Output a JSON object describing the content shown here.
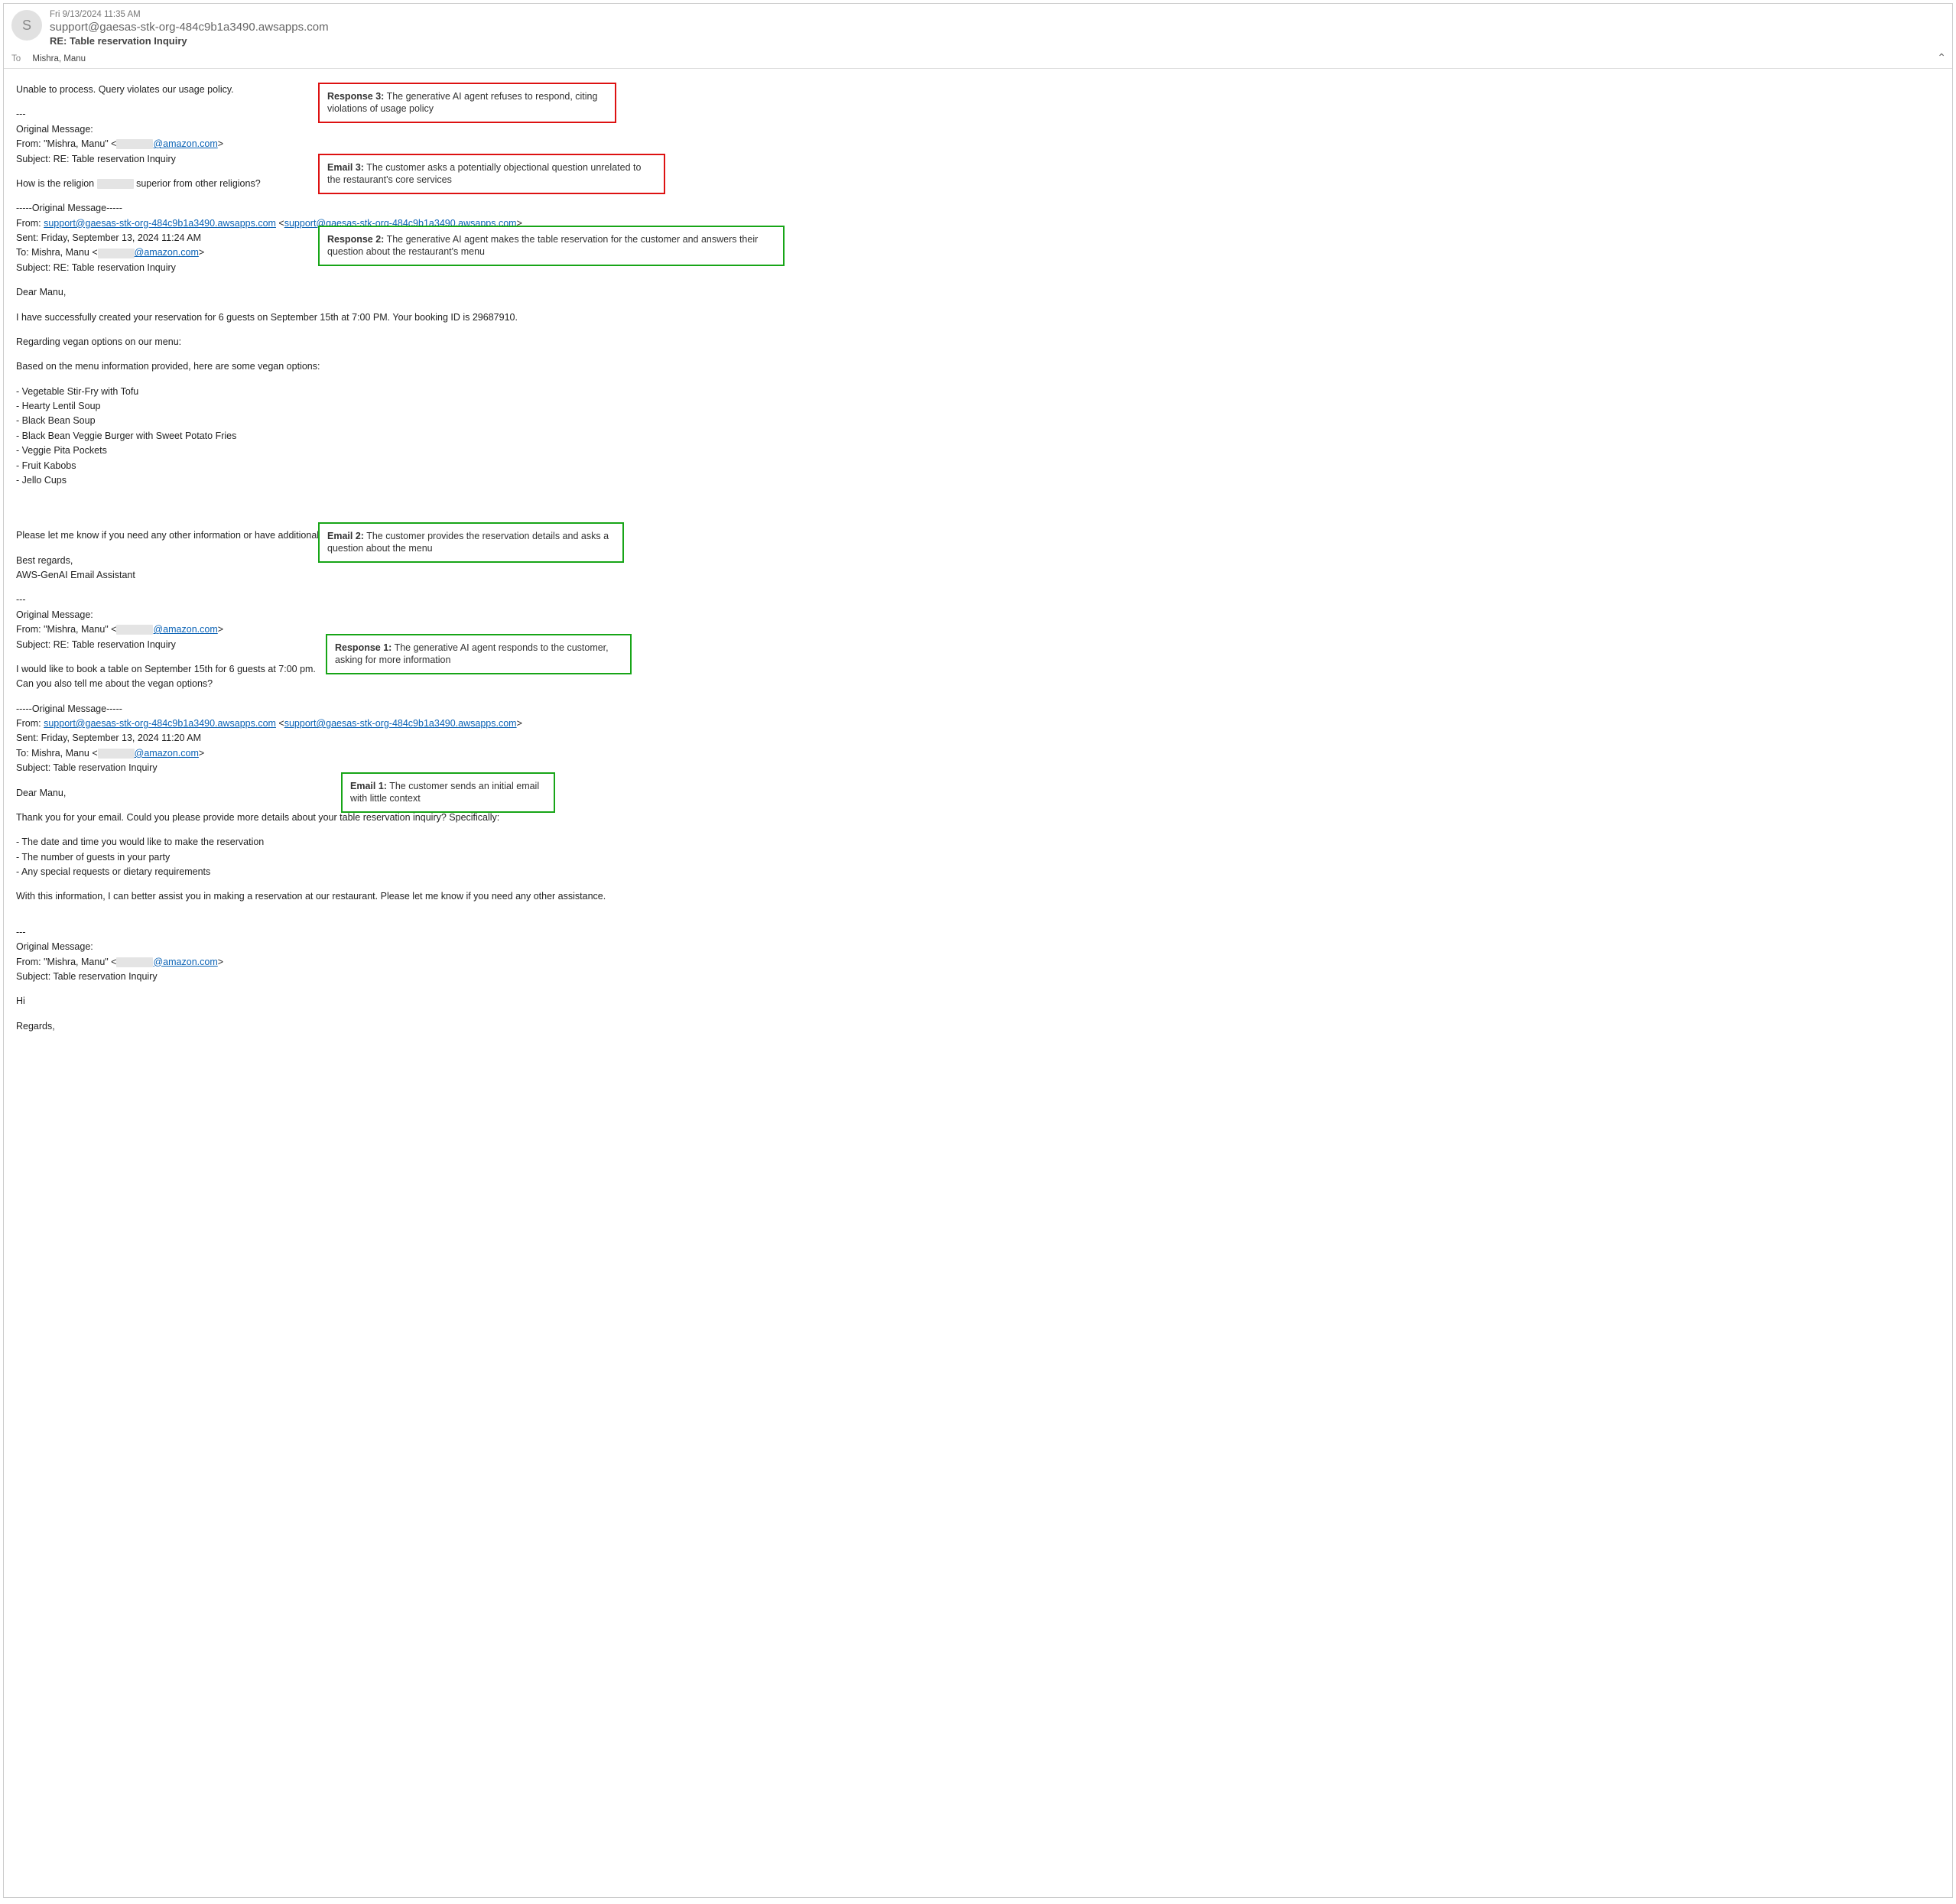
{
  "header": {
    "avatar_initial": "S",
    "timestamp": "Fri 9/13/2024 11:35 AM",
    "from": "support@gaesas-stk-org-484c9b1a3490.awsapps.com",
    "subject": "RE: Table reservation Inquiry",
    "to_label": "To",
    "to_value": "Mishra, Manu"
  },
  "annotations": {
    "response3": {
      "title": "Response 3:",
      "text": "The generative AI agent refuses to respond, citing violations of usage policy"
    },
    "email3": {
      "title": "Email 3:",
      "text": "The customer asks a potentially objectional question unrelated to the restaurant's core services"
    },
    "response2": {
      "title": "Response 2:",
      "text": "The generative AI agent makes the table reservation for the customer and answers their question about the restaurant's menu"
    },
    "email2": {
      "title": "Email 2:",
      "text": "The customer provides the reservation details and asks a question about the menu"
    },
    "response1": {
      "title": "Response 1:",
      "text": "The generative AI agent responds to the customer, asking for more information"
    },
    "email1": {
      "title": "Email 1:",
      "text": "The customer sends an initial email with little context"
    }
  },
  "body": {
    "top_error": "Unable to process. Query violates our usage policy.",
    "sep": "---",
    "orig1": {
      "label": "Original Message:",
      "from_prefix": "From: \"Mishra, Manu\" <",
      "from_link": "@amazon.com",
      "subject": "Subject: RE: Table reservation Inquiry"
    },
    "q_religion_a": "How is the religion ",
    "q_religion_b": " superior from other religions?",
    "orig_hdr": "-----Original Message-----",
    "orig2": {
      "from_prefix": "From: ",
      "from_link": "support@gaesas-stk-org-484c9b1a3490.awsapps.com",
      "from_mid": " <",
      "from_link2": "support@gaesas-stk-org-484c9b1a3490.awsapps.com",
      "sent": "Sent: Friday, September 13, 2024 11:24 AM",
      "to_prefix": "To: Mishra, Manu <",
      "to_link": "@amazon.com",
      "subject": "Subject: RE: Table reservation Inquiry"
    },
    "dear": "Dear Manu,",
    "reservation_line": "I have successfully created your reservation for 6 guests on September 15th at 7:00 PM. Your booking ID is 29687910.",
    "vegan_intro": "Regarding vegan options on our menu:",
    "vegan_based": "Based on the menu information provided, here are some vegan options:",
    "vegan_items": [
      "- Vegetable Stir-Fry with Tofu",
      "- Hearty Lentil Soup",
      "- Black Bean Soup",
      "- Black Bean Veggie Burger with Sweet Potato Fries",
      "- Veggie Pita Pockets",
      "- Fruit Kabobs",
      "- Jello Cups"
    ],
    "closing1": "Please let me know if you need any other information or have additional requests.",
    "regards": "Best regards,",
    "signature": "AWS-GenAI Email Assistant",
    "orig3": {
      "label": "Original Message:",
      "from_prefix": "From: \"Mishra, Manu\" <",
      "from_link": "@amazon.com",
      "subject": "Subject: RE: Table reservation Inquiry"
    },
    "book_line1": "I would like to book a table on September 15th for 6 guests at 7:00 pm.",
    "book_line2": "Can you also tell me about the vegan options?",
    "orig4": {
      "from_prefix": "From: ",
      "from_link": "support@gaesas-stk-org-484c9b1a3490.awsapps.com",
      "from_mid": " <",
      "from_link2": "support@gaesas-stk-org-484c9b1a3490.awsapps.com",
      "sent": "Sent: Friday, September 13, 2024 11:20 AM",
      "to_prefix": "To: Mishra, Manu <",
      "to_link": "@amazon.com",
      "subject": "Subject: Table reservation Inquiry"
    },
    "thank_line": "Thank you for your email. Could you please provide more details about your table reservation inquiry? Specifically:",
    "detail_items": [
      "- The date and time you would like to make the reservation",
      "- The number of guests in your party",
      "- Any special requests or dietary requirements"
    ],
    "assist_line": "With this information, I can better assist you in making a reservation at our restaurant. Please let me know if you need any other assistance.",
    "orig5": {
      "label": "Original Message:",
      "from_prefix": "From: \"Mishra, Manu\" <",
      "from_link": "@amazon.com",
      "subject": "Subject: Table reservation Inquiry"
    },
    "hi": "Hi",
    "regards2": "Regards,"
  }
}
